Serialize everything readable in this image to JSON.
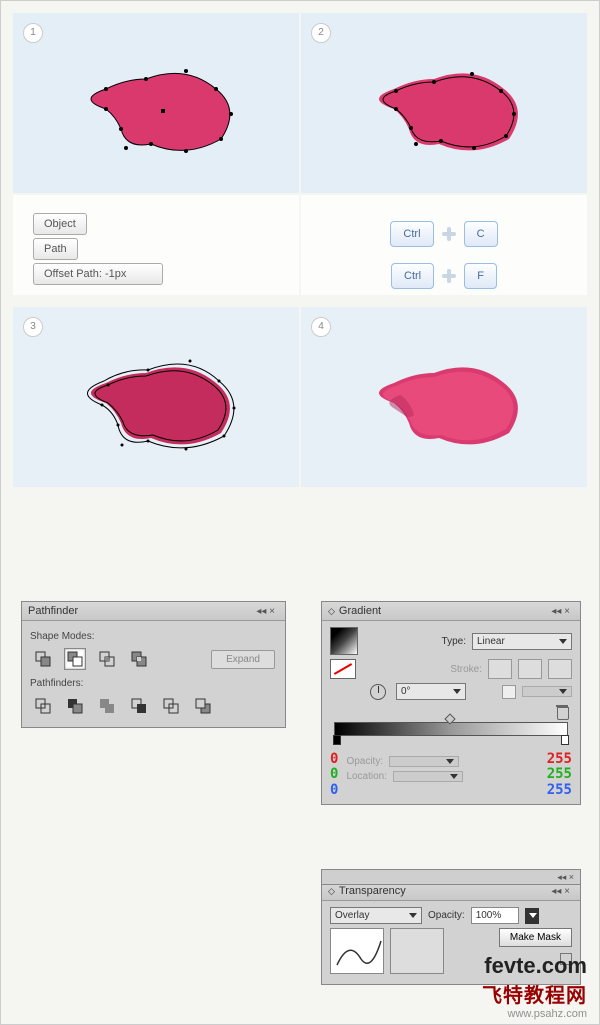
{
  "steps": {
    "s1": "1",
    "s2": "2",
    "s3": "3",
    "s4": "4"
  },
  "object_menu": {
    "object": "Object",
    "path": "Path",
    "offset": "Offset Path: -1px"
  },
  "keys": {
    "ctrl": "Ctrl",
    "c": "C",
    "f": "F"
  },
  "pathfinder": {
    "title": "Pathfinder",
    "shape_modes": "Shape Modes:",
    "pathfinders_label": "Pathfinders:",
    "expand": "Expand"
  },
  "gradient": {
    "title": "Gradient",
    "type_label": "Type:",
    "type_value": "Linear",
    "stroke_label": "Stroke:",
    "angle_value": "0°",
    "opacity_label": "Opacity:",
    "location_label": "Location:",
    "left_r": "0",
    "left_g": "0",
    "left_b": "0",
    "right_r": "255",
    "right_g": "255",
    "right_b": "255"
  },
  "transparency": {
    "title": "Transparency",
    "mode": "Overlay",
    "opacity_label": "Opacity:",
    "opacity_value": "100%",
    "make_mask": "Make Mask"
  },
  "watermark": {
    "brand_en": "fevte.com",
    "brand_cn": "飞特教程网",
    "url": "www.psahz.com"
  },
  "chart_data": null
}
